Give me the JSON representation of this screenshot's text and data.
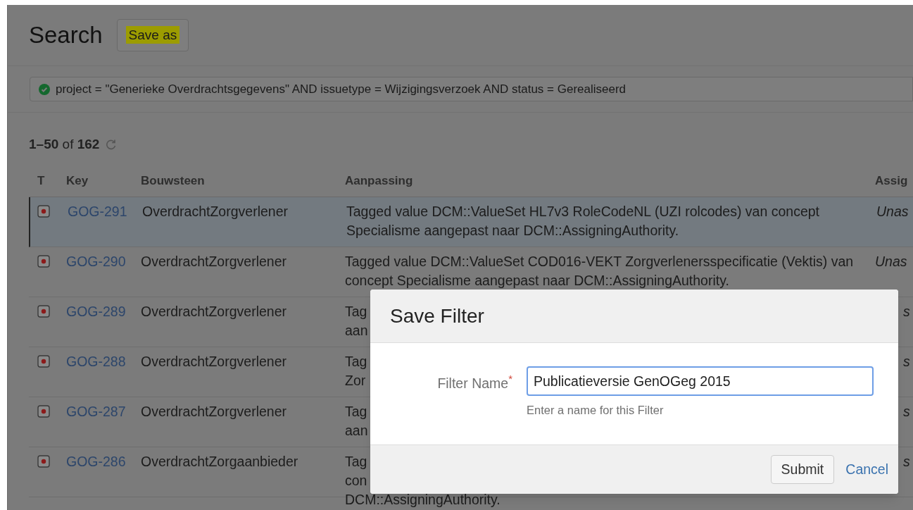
{
  "header": {
    "title": "Search",
    "save_as_button": {
      "label": "Save as",
      "highlighted": true
    }
  },
  "query": {
    "valid": true,
    "text": "project = \"Generieke Overdrachtsgegevens\" AND issuetype = Wijzigingsverzoek AND status = Gerealiseerd"
  },
  "results": {
    "range": "1–50",
    "of": "of",
    "total": "162"
  },
  "table": {
    "columns": [
      "T",
      "Key",
      "Bouwsteen",
      "Aanpassing",
      "Assig"
    ],
    "rows": [
      {
        "key": "GOG-291",
        "bouwsteen": "OverdrachtZorgverlener",
        "aanpassing": [
          "Tagged value DCM::ValueSet HL7v3 RoleCodeNL (UZI rolcodes) van concept",
          "Specialisme aangepast naar DCM::AssigningAuthority."
        ],
        "assignee": "Unas",
        "selected": true
      },
      {
        "key": "GOG-290",
        "bouwsteen": "OverdrachtZorgverlener",
        "aanpassing": [
          "Tagged value DCM::ValueSet COD016-VEKT Zorgverlenersspecificatie (Vektis) van",
          "concept Specialisme aangepast naar DCM::AssigningAuthority."
        ],
        "assignee": "Unas",
        "selected": false
      },
      {
        "key": "GOG-289",
        "bouwsteen": "OverdrachtZorgverlener",
        "aanpassing": [
          "Tag",
          "aan"
        ],
        "assignee": "s",
        "selected": false
      },
      {
        "key": "GOG-288",
        "bouwsteen": "OverdrachtZorgverlener",
        "aanpassing": [
          "Tag",
          "Zor"
        ],
        "assignee": "s",
        "selected": false
      },
      {
        "key": "GOG-287",
        "bouwsteen": "OverdrachtZorgverlener",
        "aanpassing": [
          "Tag",
          "aan"
        ],
        "assignee": "s",
        "selected": false
      },
      {
        "key": "GOG-286",
        "bouwsteen": "OverdrachtZorgaanbieder",
        "aanpassing": [
          "Tag",
          "con",
          "DCM::AssigningAuthority."
        ],
        "assignee": "s",
        "selected": false
      }
    ]
  },
  "dialog": {
    "title": "Save Filter",
    "field_label": "Filter Name",
    "required_mark": "*",
    "value": "Publicatieversie GenOGeg 2015",
    "hint": "Enter a name for this Filter",
    "submit": "Submit",
    "cancel": "Cancel"
  }
}
